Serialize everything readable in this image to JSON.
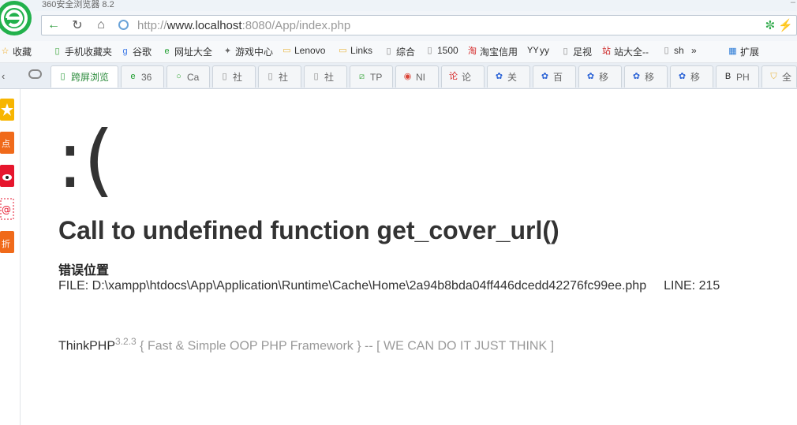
{
  "browser": {
    "title": "360安全浏览器 8.2",
    "url_prefix": "http://",
    "url_host": "www.localhost",
    "url_rest": ":8080/App/index.php"
  },
  "bookmarks": [
    {
      "icon": "star-icon",
      "label": "收藏",
      "color": "#f0a30a"
    },
    {
      "icon": "phone-icon",
      "label": "手机收藏夹",
      "color": "#3aa53a"
    },
    {
      "icon": "google-icon",
      "label": "谷歌",
      "color": "#3b78e7"
    },
    {
      "icon": "ie-icon",
      "label": "网址大全",
      "color": "#1f9e2f"
    },
    {
      "icon": "gamepad-icon",
      "label": "游戏中心",
      "color": "#666"
    },
    {
      "icon": "folder-icon",
      "label": "Lenovo",
      "color": "#e8b33a"
    },
    {
      "icon": "folder-icon",
      "label": "Links",
      "color": "#e8b33a"
    },
    {
      "icon": "page-icon",
      "label": "综合",
      "color": "#888"
    },
    {
      "icon": "page-icon",
      "label": "1500",
      "color": "#888"
    },
    {
      "icon": "taobao-icon",
      "label": "淘宝信用",
      "color": "#d42424"
    },
    {
      "icon": "yy-icon",
      "label": "yy",
      "color": "#222"
    },
    {
      "icon": "page-icon",
      "label": "足视",
      "color": "#888"
    },
    {
      "icon": "station-icon",
      "label": "站大全--",
      "color": "#c22"
    },
    {
      "icon": "page-icon",
      "label": "sh",
      "color": "#888"
    },
    {
      "icon": "apps-icon",
      "label": "扩展",
      "color": "#2a7ad6"
    }
  ],
  "tabs": [
    {
      "label": "跨屏浏览",
      "icon": "phone-icon",
      "color": "#2a9a3a",
      "active": true
    },
    {
      "label": "36",
      "icon": "ie-icon",
      "color": "#1f9e2f"
    },
    {
      "label": "Ca",
      "icon": "circle-icon",
      "color": "#3aaa3a"
    },
    {
      "label": "社",
      "icon": "page-icon",
      "color": "#888"
    },
    {
      "label": "社",
      "icon": "page-icon",
      "color": "#888"
    },
    {
      "label": "社",
      "icon": "page-icon",
      "color": "#888"
    },
    {
      "label": "TP",
      "icon": "tp-icon",
      "color": "#4caf50"
    },
    {
      "label": "NI",
      "icon": "chrome-icon",
      "color": "#db4437"
    },
    {
      "label": "论",
      "icon": "lun-icon",
      "color": "#d62828"
    },
    {
      "label": "关",
      "icon": "paw-icon",
      "color": "#2b63d6"
    },
    {
      "label": "百",
      "icon": "paw-icon",
      "color": "#2b63d6"
    },
    {
      "label": "移",
      "icon": "paw-icon",
      "color": "#2b63d6"
    },
    {
      "label": "移",
      "icon": "paw-icon",
      "color": "#2b63d6"
    },
    {
      "label": "移",
      "icon": "paw-icon",
      "color": "#2b63d6"
    },
    {
      "label": "PH",
      "icon": "b-icon",
      "color": "#222"
    },
    {
      "label": "全",
      "icon": "shield-icon",
      "color": "#e8b33a"
    }
  ],
  "error": {
    "face": ":(",
    "message": "Call to undefined function get_cover_url()",
    "location_label": "错误位置",
    "file": "FILE: D:\\xampp\\htdocs\\App\\Application\\Runtime\\Cache\\Home\\2a94b8bda04ff446dcedd42276fc99ee.php",
    "line": "LINE: 215"
  },
  "footer": {
    "brand": "ThinkPHP",
    "version": "3.2.3",
    "slogan": " { Fast & Simple OOP PHP Framework } -- [ WE CAN DO IT JUST THINK ]"
  }
}
